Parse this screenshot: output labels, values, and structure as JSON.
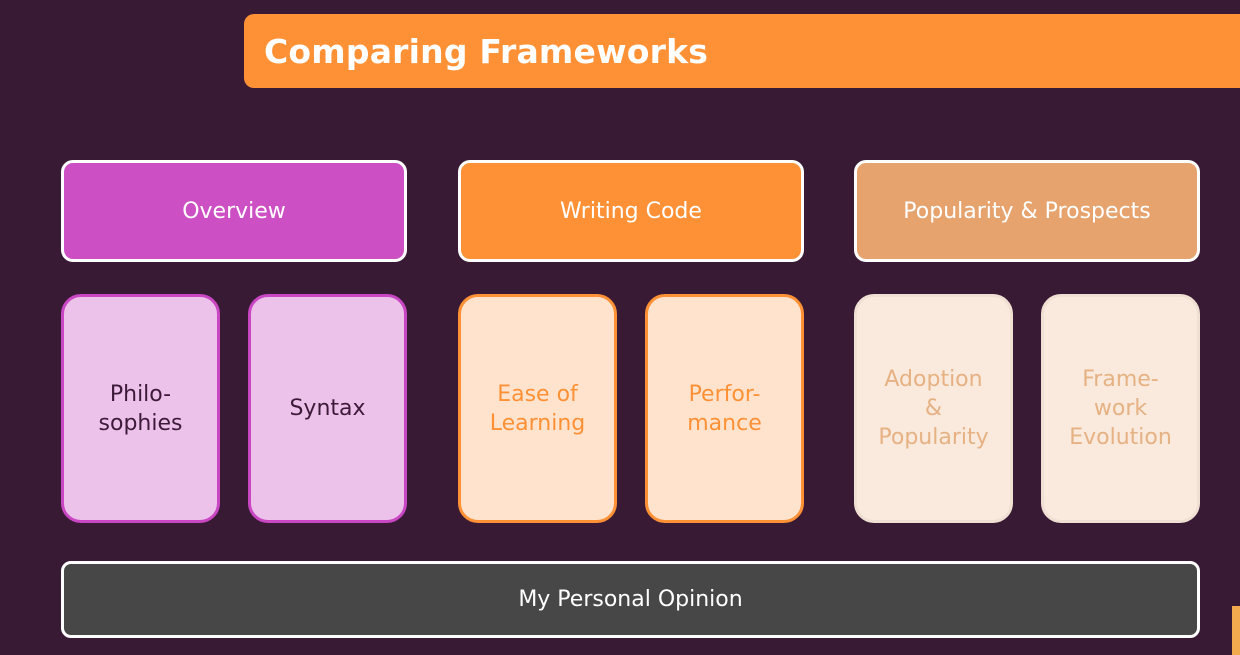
{
  "title": "Comparing Frameworks",
  "sections": [
    {
      "label": "Overview",
      "color": "#cc4fc4",
      "items": [
        "Philo-\nsophies",
        "Syntax"
      ],
      "item_bg": "#edc2ea",
      "item_border": "#ca47c4",
      "item_text": "#3d1a3a"
    },
    {
      "label": "Writing Code",
      "color": "#fe9136",
      "items": [
        "Ease of\nLearning",
        "Perfor-\nmance"
      ],
      "item_bg": "#ffe3cd",
      "item_border": "#fe9136",
      "item_text": "#fe9136"
    },
    {
      "label": "Popularity & Prospects",
      "color": "#e6a36e",
      "items": [
        "Adoption\n&\nPopularity",
        "Frame-\nwork\nEvolution"
      ],
      "item_bg": "#f9eadd",
      "item_border": "#f0e0d3",
      "item_text": "#e6b183"
    }
  ],
  "footer": "My Personal Opinion",
  "colors": {
    "background": "#391a35",
    "title_bar": "#fe9136",
    "footer_bg": "#474747"
  }
}
